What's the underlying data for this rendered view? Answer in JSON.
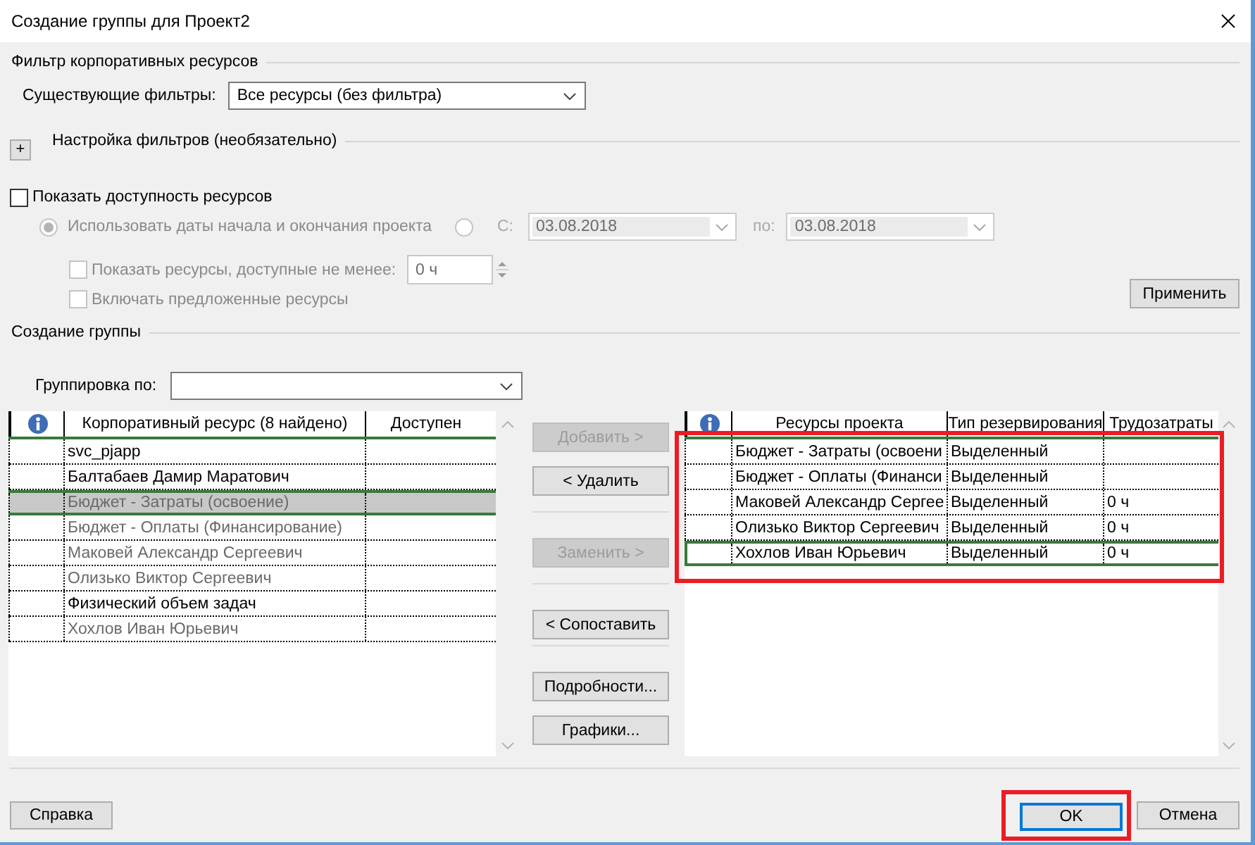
{
  "window": {
    "title": "Создание группы для Проект2"
  },
  "enterprise_filter": {
    "title": "Фильтр корпоративных ресурсов",
    "existing_filters": {
      "label": "Существующие фильтры:",
      "value": "Все ресурсы (без фильтра)"
    }
  },
  "custom_filters": {
    "toggle": "+",
    "title": "Настройка фильтров (необязательно)"
  },
  "availability": {
    "label": "Показать доступность ресурсов",
    "checked": false,
    "options_disabled": true,
    "date_options": [
      {
        "label": "Использовать даты начала и окончания проекта",
        "selected": true
      },
      {
        "selected": false
      }
    ],
    "from": {
      "label": "С:",
      "value": "03.08.2018"
    },
    "to": {
      "label": "по:",
      "value": "03.08.2018"
    },
    "min_available": {
      "label": "Показать ресурсы, доступные не менее:",
      "checked": false,
      "value": "0 ч"
    },
    "include_proposed": {
      "label": "Включать предложенные ресурсы",
      "checked": false
    },
    "apply_button": "Применить"
  },
  "build_team": {
    "title": "Создание группы",
    "group_by": {
      "label": "Группировка по:"
    }
  },
  "enterprise_table": {
    "columns": [
      "Корпоративный ресурс (8 найдено)",
      "Доступен"
    ],
    "rows": [
      {
        "name": "svc_pjapp",
        "greyed": false,
        "selected": false
      },
      {
        "name": "Балтабаев Дамир Маратович",
        "greyed": false,
        "selected": false
      },
      {
        "name": "Бюджет - Затраты (освоение)",
        "greyed": true,
        "selected": true
      },
      {
        "name": "Бюджет - Оплаты (Финансирование)",
        "greyed": true,
        "selected": false
      },
      {
        "name": "Маковей Александр Сергеевич",
        "greyed": true,
        "selected": false
      },
      {
        "name": "Олизько Виктор Сергеевич",
        "greyed": true,
        "selected": false
      },
      {
        "name": "Физический объем задач",
        "greyed": false,
        "selected": false
      },
      {
        "name": "Хохлов Иван Юрьевич",
        "greyed": true,
        "selected": false
      }
    ]
  },
  "actions": [
    [
      {
        "label": "Добавить >",
        "disabled": true
      },
      {
        "label": "< Удалить",
        "disabled": false
      }
    ],
    [
      {
        "label": "Заменить >",
        "disabled": true
      }
    ],
    [
      {
        "label": "< Сопоставить",
        "disabled": false
      }
    ],
    [
      {
        "label": "Подробности...",
        "disabled": false
      },
      {
        "label": "Графики...",
        "disabled": false
      }
    ]
  ],
  "project_table": {
    "highlighted": true,
    "columns": [
      "Ресурсы проекта",
      "Тип резервирования",
      "Трудозатраты"
    ],
    "rows": [
      {
        "resource": "Бюджет - Затраты (освоени",
        "booking_type": "Выделенный",
        "selected": false
      },
      {
        "resource": "Бюджет - Оплаты (Финанси",
        "booking_type": "Выделенный",
        "selected": false
      },
      {
        "resource": "Маковей Александр Сергее",
        "booking_type": "Выделенный",
        "work": "0 ч",
        "selected": false
      },
      {
        "resource": "Олизько Виктор Сергеевич",
        "booking_type": "Выделенный",
        "work": "0 ч",
        "selected": false
      },
      {
        "resource": "Хохлов Иван Юрьевич",
        "booking_type": "Выделенный",
        "work": "0 ч",
        "selected": true
      }
    ]
  },
  "footer": {
    "help_button": "Справка",
    "buttons": [
      {
        "label": "OK",
        "default": true,
        "highlighted": true
      },
      {
        "label": "Отмена",
        "default": false,
        "highlighted": false
      }
    ]
  }
}
